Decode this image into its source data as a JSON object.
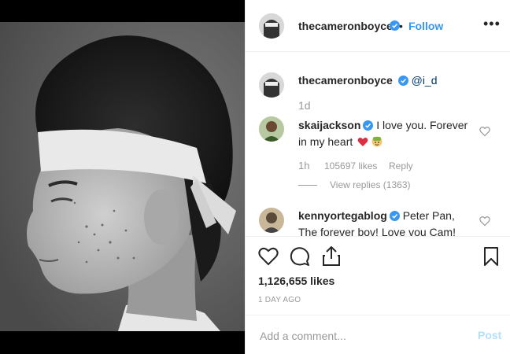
{
  "header": {
    "username": "thecameronboyce",
    "dot": "•",
    "follow": "Follow",
    "more": "•••"
  },
  "caption": {
    "username": "thecameronboyce",
    "text": "@i_d",
    "time": "1d"
  },
  "comments": [
    {
      "username": "skaijackson",
      "text_line1": "I love you. Forever",
      "text_line2": "in my heart",
      "time": "1h",
      "likes": "105697 likes",
      "reply": "Reply",
      "view_replies": "View replies (1363)"
    },
    {
      "username": "kennyortegablog",
      "text_line1": "Peter Pan,",
      "text_line2": "The forever bov! Love vou Cam!"
    }
  ],
  "actions": {
    "likes": "1,126,655 likes",
    "time": "1 DAY AGO"
  },
  "comment_box": {
    "placeholder": "Add a comment...",
    "post": "Post"
  },
  "colors": {
    "accent": "#3897f0",
    "post_disabled": "#b2dffc",
    "muted": "#999999",
    "heart_red": "#e0245e"
  }
}
